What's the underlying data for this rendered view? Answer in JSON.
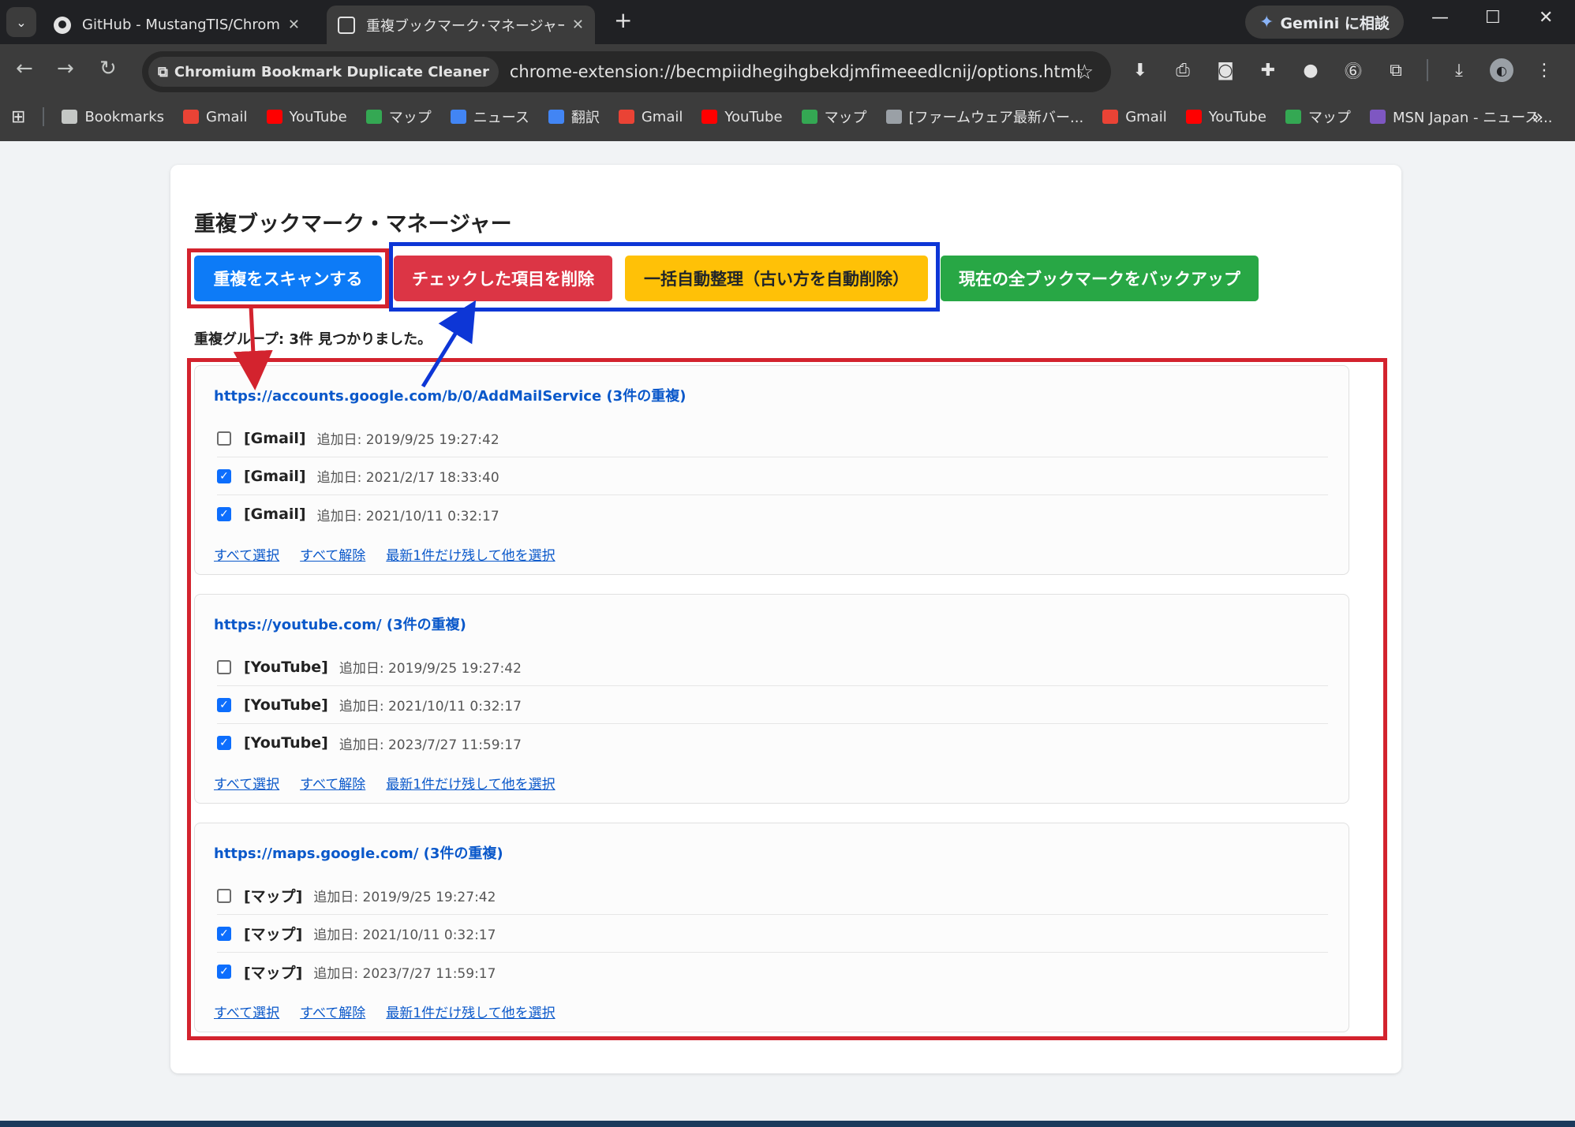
{
  "browser": {
    "tabs": [
      {
        "title": "GitHub - MustangTIS/Chromiun",
        "active": false
      },
      {
        "title": "重複ブックマーク･マネージャー",
        "active": true
      }
    ],
    "gemini_label": "Gemini に相談",
    "site_chip": "Chromium Bookmark Duplicate Cleaner",
    "url": "chrome-extension://becmpiidhegihgbekdjmfimeeedlcnij/options.html",
    "bookmarks": [
      {
        "label": "Bookmarks",
        "color": "#c4c7c5"
      },
      {
        "label": "Gmail",
        "color": "#ea4335"
      },
      {
        "label": "YouTube",
        "color": "#ff0000"
      },
      {
        "label": "マップ",
        "color": "#34a853"
      },
      {
        "label": "ニュース",
        "color": "#4285f4"
      },
      {
        "label": "翻訳",
        "color": "#4285f4"
      },
      {
        "label": "Gmail",
        "color": "#ea4335"
      },
      {
        "label": "YouTube",
        "color": "#ff0000"
      },
      {
        "label": "マップ",
        "color": "#34a853"
      },
      {
        "label": "[ファームウェア最新バー...",
        "color": "#9aa0a6"
      },
      {
        "label": "Gmail",
        "color": "#ea4335"
      },
      {
        "label": "YouTube",
        "color": "#ff0000"
      },
      {
        "label": "マップ",
        "color": "#34a853"
      },
      {
        "label": "MSN Japan - ニュース...",
        "color": "#7e57c2"
      }
    ]
  },
  "page": {
    "title": "重複ブックマーク・マネージャー",
    "buttons": {
      "scan": "重複をスキャンする",
      "delete": "チェックした項目を削除",
      "auto": "一括自動整理（古い方を自動削除）",
      "backup": "現在の全ブックマークをバックアップ"
    },
    "result": "重複グループ: 3件 見つかりました。",
    "group_links": {
      "select_all": "すべて選択",
      "deselect_all": "すべて解除",
      "keep_latest": "最新1件だけ残して他を選択"
    },
    "groups": [
      {
        "header": "https://accounts.google.com/b/0/AddMailService (3件の重複)",
        "items": [
          {
            "title": "[Gmail]",
            "date": "追加日: 2019/9/25 19:27:42",
            "checked": false
          },
          {
            "title": "[Gmail]",
            "date": "追加日: 2021/2/17 18:33:40",
            "checked": true
          },
          {
            "title": "[Gmail]",
            "date": "追加日: 2021/10/11 0:32:17",
            "checked": true
          }
        ]
      },
      {
        "header": "https://youtube.com/ (3件の重複)",
        "items": [
          {
            "title": "[YouTube]",
            "date": "追加日: 2019/9/25 19:27:42",
            "checked": false
          },
          {
            "title": "[YouTube]",
            "date": "追加日: 2021/10/11 0:32:17",
            "checked": true
          },
          {
            "title": "[YouTube]",
            "date": "追加日: 2023/7/27 11:59:17",
            "checked": true
          }
        ]
      },
      {
        "header": "https://maps.google.com/ (3件の重複)",
        "items": [
          {
            "title": "[マップ]",
            "date": "追加日: 2019/9/25 19:27:42",
            "checked": false
          },
          {
            "title": "[マップ]",
            "date": "追加日: 2021/10/11 0:32:17",
            "checked": true
          },
          {
            "title": "[マップ]",
            "date": "追加日: 2023/7/27 11:59:17",
            "checked": true
          }
        ]
      }
    ]
  },
  "colors": {
    "scan": "#0d7bf7",
    "delete": "#dc3545",
    "auto": "#ffc107",
    "backup": "#28a745",
    "annotation_red": "#d3232e",
    "annotation_blue": "#0d36d6"
  }
}
